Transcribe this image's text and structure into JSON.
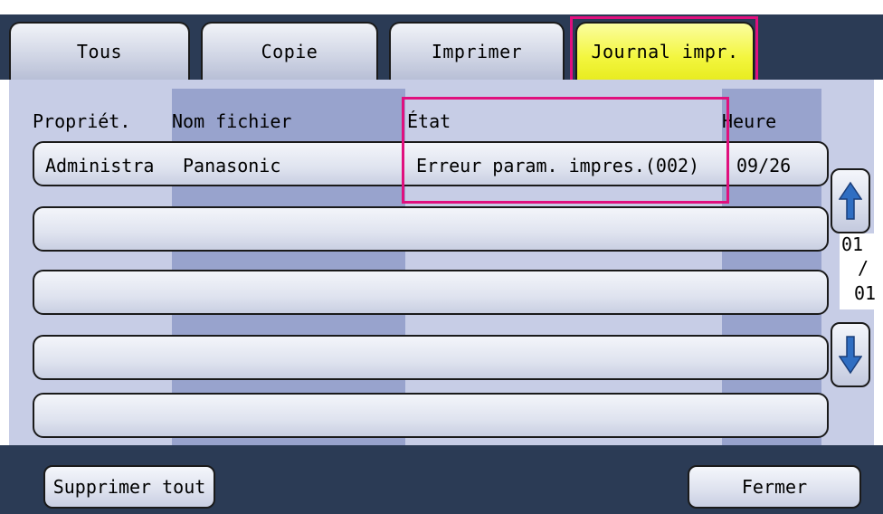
{
  "tabs": [
    {
      "label": "Tous"
    },
    {
      "label": "Copie"
    },
    {
      "label": "Imprimer"
    },
    {
      "label": "Journal impr.",
      "active": true
    }
  ],
  "columns": {
    "owner": "Propriét.",
    "filename": "Nom fichier",
    "state": "État",
    "time": "Heure"
  },
  "rows": [
    {
      "owner": "Administra",
      "filename": "Panasonic",
      "state": "Erreur param. impres.(002)",
      "time": "09/26"
    },
    {
      "owner": "",
      "filename": "",
      "state": "",
      "time": ""
    },
    {
      "owner": "",
      "filename": "",
      "state": "",
      "time": ""
    },
    {
      "owner": "",
      "filename": "",
      "state": "",
      "time": ""
    },
    {
      "owner": "",
      "filename": "",
      "state": "",
      "time": ""
    }
  ],
  "pagination": {
    "current": "01",
    "separator": "/",
    "total": "01"
  },
  "icons": {
    "scroll_up": "arrow-up-icon",
    "scroll_down": "arrow-down-icon"
  },
  "footer": {
    "delete_all": "Supprimer tout",
    "close": "Fermer"
  },
  "colors": {
    "highlight": "#e0107e",
    "active_tab": "#f3f63f",
    "bar": "#2b3b55"
  }
}
